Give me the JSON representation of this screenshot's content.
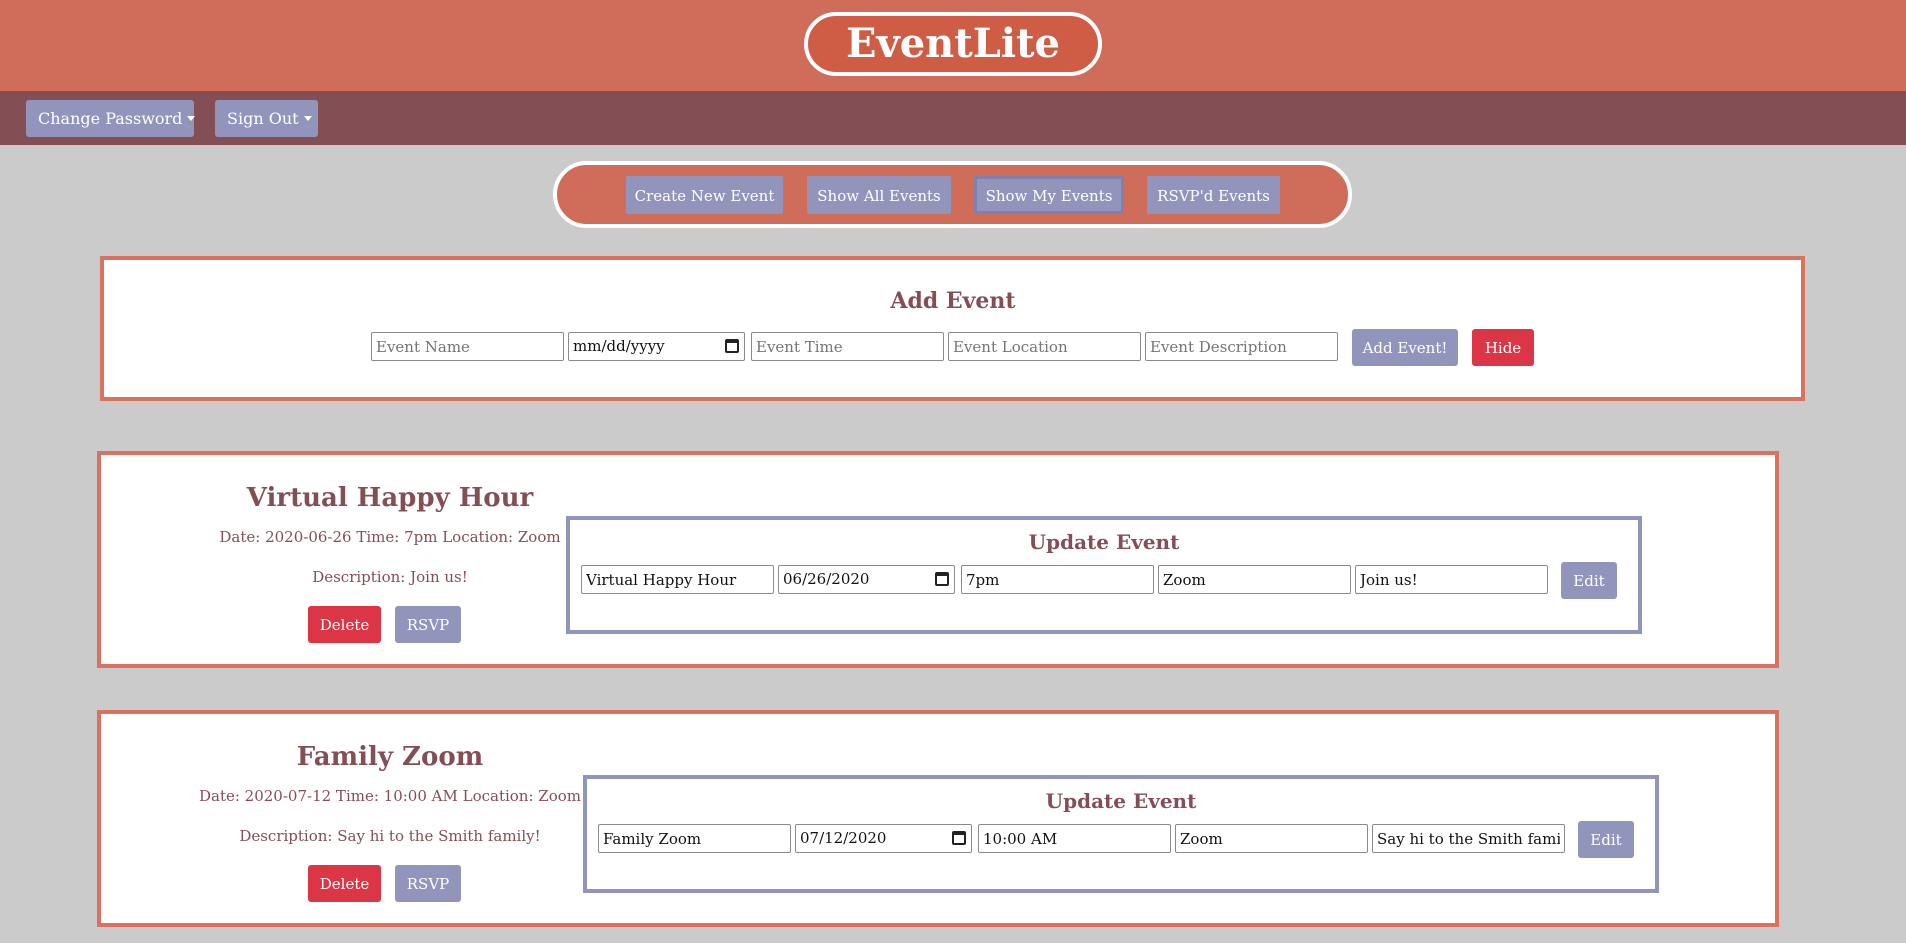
{
  "app": {
    "title": "EventLite",
    "nav": {
      "change_password": "Change Password",
      "sign_out": "Sign Out"
    },
    "tabs": [
      "Create New Event",
      "Show All Events",
      "Show My Events",
      "RSVP'd Events"
    ]
  },
  "add_event": {
    "title": "Add Event",
    "placeholders": {
      "name": "Event Name",
      "date": "mm/dd/yyyy",
      "time": "Event Time",
      "location": "Event Location",
      "description": "Event Description"
    },
    "submit_label": "Add Event!",
    "hide_label": "Hide"
  },
  "events": [
    {
      "name": "Virtual Happy Hour",
      "details": "Date: 2020-06-26 Time: 7pm Location: Zoom",
      "description": "Description: Join us!",
      "delete_label": "Delete",
      "rsvp_label": "RSVP",
      "update": {
        "title": "Update Event",
        "name": "Virtual Happy Hour",
        "date": "06/26/2020",
        "time": "7pm",
        "location": "Zoom",
        "description": "Join us!",
        "edit_label": "Edit"
      }
    },
    {
      "name": "Family Zoom",
      "details": "Date: 2020-07-12 Time: 10:00 AM Location: Zoom",
      "description": "Description: Say hi to the Smith family!",
      "delete_label": "Delete",
      "rsvp_label": "RSVP",
      "update": {
        "title": "Update Event",
        "name": "Family Zoom",
        "date": "07/12/2020",
        "time": "10:00 AM",
        "location": "Zoom",
        "description": "Say hi to the Smith family!",
        "edit_label": "Edit"
      }
    }
  ],
  "colors": {
    "header": "#cf6d5a",
    "navbar": "#834f55",
    "accent_purple": "#9295bb",
    "danger_red": "#dc3546",
    "page_bg": "#cbcbcb"
  }
}
